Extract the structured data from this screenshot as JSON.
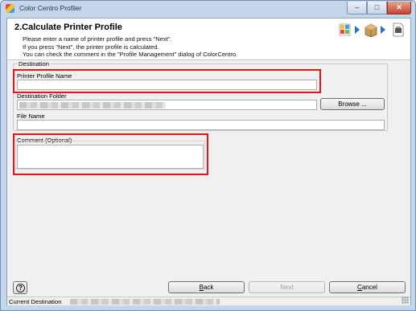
{
  "window": {
    "title": "Color Centro Profiler",
    "buttons": {
      "minimize": "–",
      "maximize": "□",
      "close": "✕"
    }
  },
  "header": {
    "step_title": "2.Calculate Printer Profile",
    "instructions": [
      "Please enter a name of printer profile and press \"Next\".",
      "If you press \"Next\", the printer profile is calculated.",
      "You can check the comment in the \"Profile Management\" dialog of ColorCentro."
    ],
    "step_icons": [
      "chart-icon",
      "arrow-icon",
      "printer-box-icon",
      "arrow-icon",
      "profile-doc-icon"
    ]
  },
  "destination": {
    "group_label": "Destination",
    "printer_profile_name": {
      "label": "Printer Profile Name",
      "value": ""
    },
    "destination_folder": {
      "label": "Destination Folder",
      "value_redacted": true
    },
    "browse_button": "Browse ...",
    "file_name": {
      "label": "File Name",
      "value": ""
    }
  },
  "comment": {
    "label": "Comment (Optional)",
    "value": ""
  },
  "footer": {
    "help_button": "?",
    "back_button": "Back",
    "back_mnemonic": "B",
    "back_rest": "ack",
    "next_button": "Next",
    "cancel_button": "Cancel",
    "cancel_mnemonic": "C",
    "cancel_rest": "ancel"
  },
  "statusbar": {
    "label": "Current Destination",
    "value_redacted": true
  },
  "colors": {
    "highlight": "#e8141b",
    "window_frame": "#c3d6ea",
    "client_bg": "#f0f0f0"
  }
}
